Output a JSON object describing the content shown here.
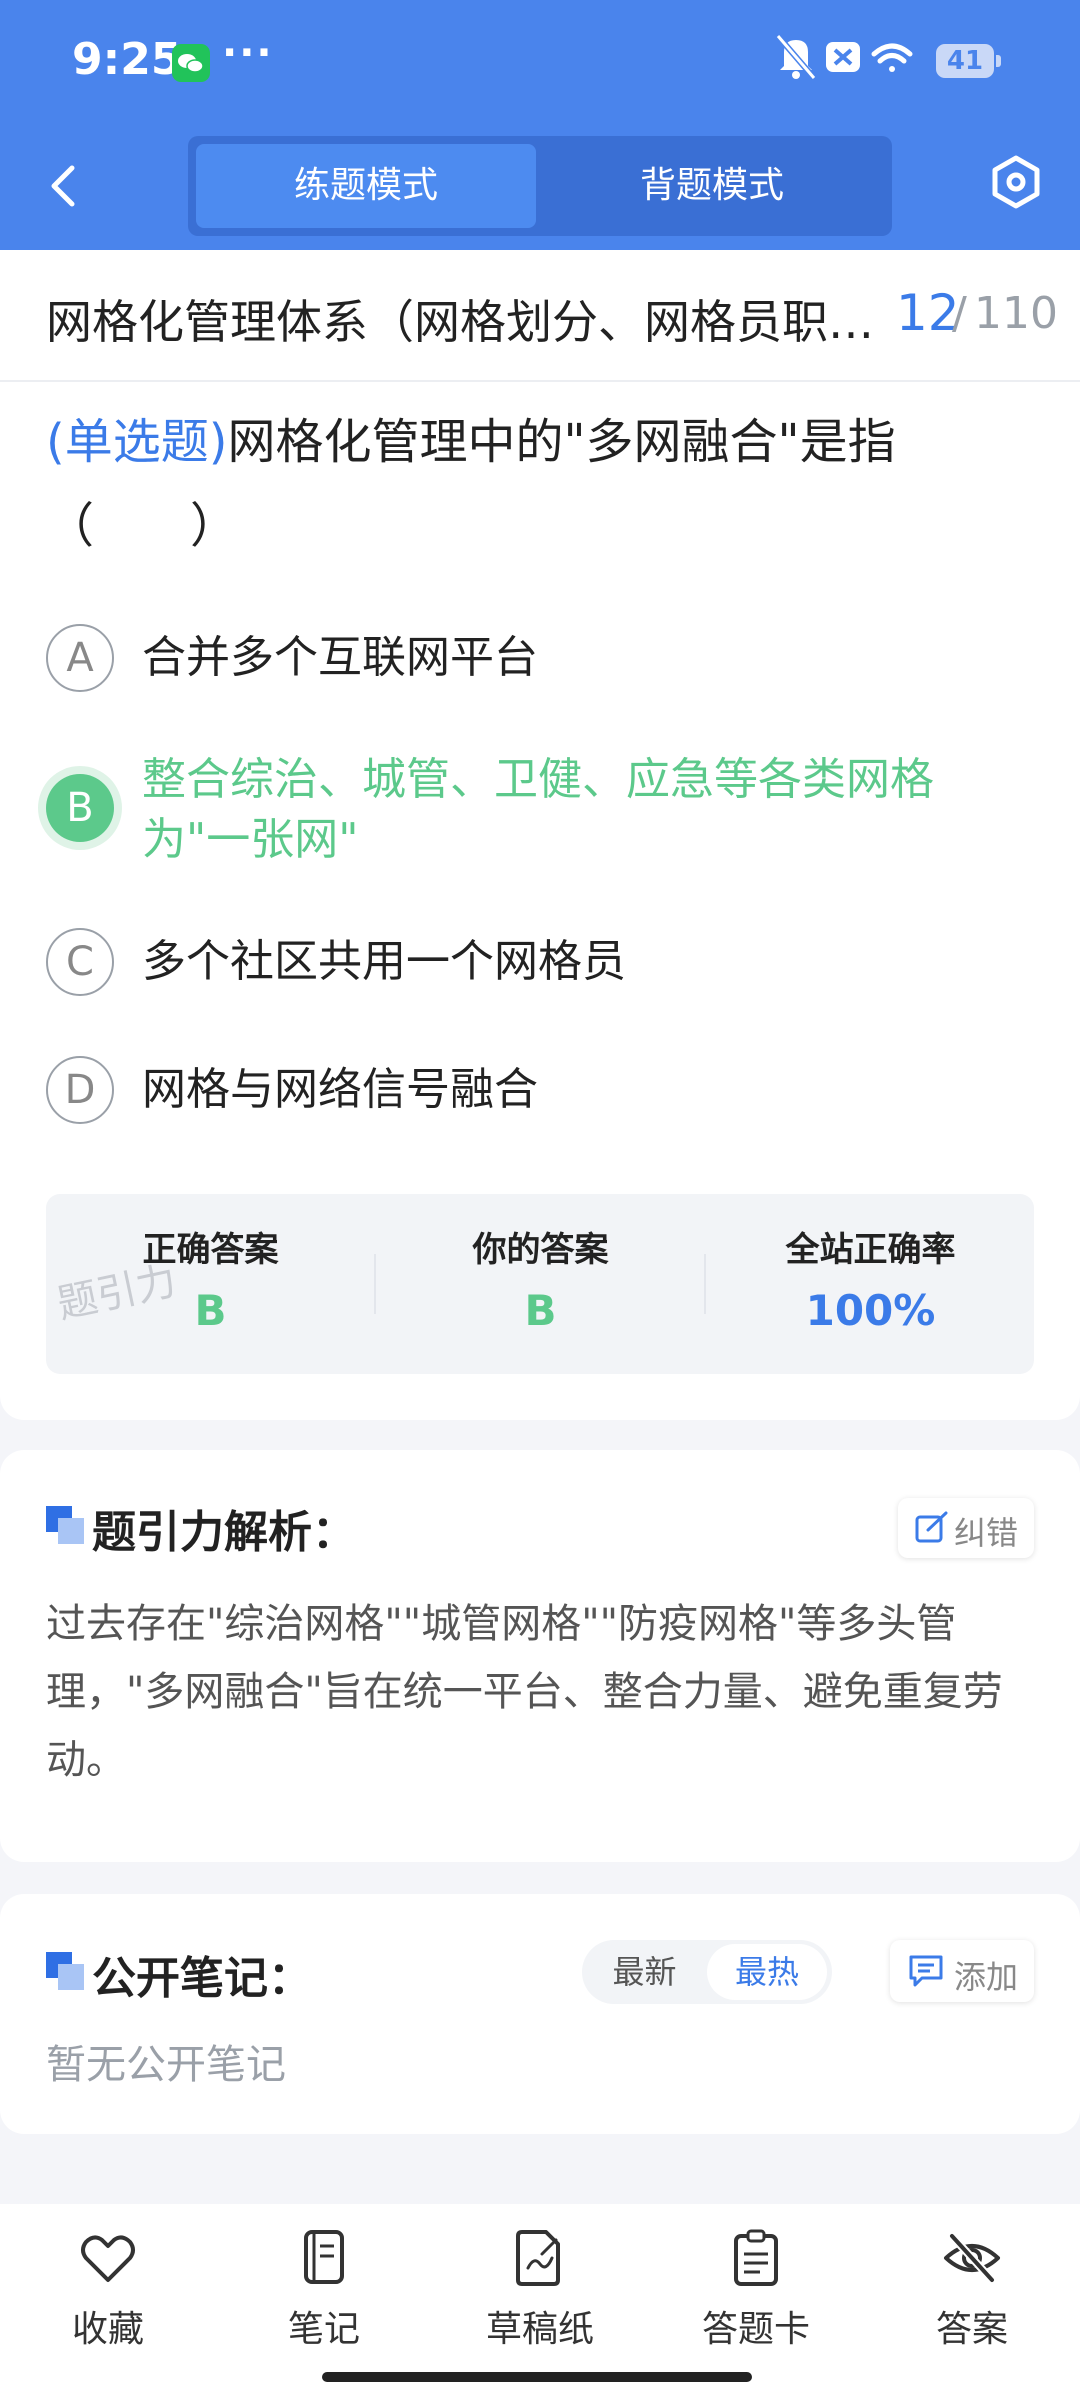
{
  "status_bar": {
    "time": "9:25",
    "dots": "···",
    "battery": "41"
  },
  "header": {
    "tabs": [
      {
        "label": "练题模式",
        "active": true
      },
      {
        "label": "背题模式",
        "active": false
      }
    ]
  },
  "title_bar": {
    "chapter": "网格化管理体系（网格划分、网格员职责与管理）",
    "current": "12",
    "separator": "/",
    "total": "110"
  },
  "question": {
    "type": "(单选题)",
    "text": "网格化管理中的\"多网融合\"是指",
    "blank": "（　　）",
    "options": [
      {
        "letter": "A",
        "text": "合并多个互联网平台",
        "state": "normal"
      },
      {
        "letter": "B",
        "text": "整合综治、城管、卫健、应急等各类网格为\"一张网\"",
        "state": "correct"
      },
      {
        "letter": "C",
        "text": "多个社区共用一个网格员",
        "state": "normal"
      },
      {
        "letter": "D",
        "text": "网格与网络信号融合",
        "state": "normal"
      }
    ]
  },
  "answer_panel": {
    "watermark": "题引力",
    "correct": {
      "label": "正确答案",
      "value": "B"
    },
    "yours": {
      "label": "你的答案",
      "value": "B"
    },
    "rate": {
      "label": "全站正确率",
      "value": "100%"
    },
    "colors": {
      "correct": "#5cc98b",
      "rate": "#3b7be8"
    }
  },
  "analysis": {
    "title": "题引力解析：",
    "correction_label": "纠错",
    "text": "过去存在\"综治网格\"\"城管网格\"\"防疫网格\"等多头管理，\"多网融合\"旨在统一平台、整合力量、避免重复劳动。"
  },
  "notes": {
    "title": "公开笔记：",
    "sort_latest": "最新",
    "sort_hot": "最热",
    "add_label": "添加",
    "empty_text": "暂无公开笔记"
  },
  "bottom_bar": {
    "items": [
      {
        "label": "收藏",
        "icon": "heart-icon"
      },
      {
        "label": "笔记",
        "icon": "notebook-icon"
      },
      {
        "label": "草稿纸",
        "icon": "draft-paper-icon"
      },
      {
        "label": "答题卡",
        "icon": "answer-card-icon"
      },
      {
        "label": "答案",
        "icon": "eye-off-icon"
      }
    ]
  },
  "colors": {
    "header": "#4a84ec",
    "accent": "#3b7be8",
    "correct": "#5cc98b"
  }
}
